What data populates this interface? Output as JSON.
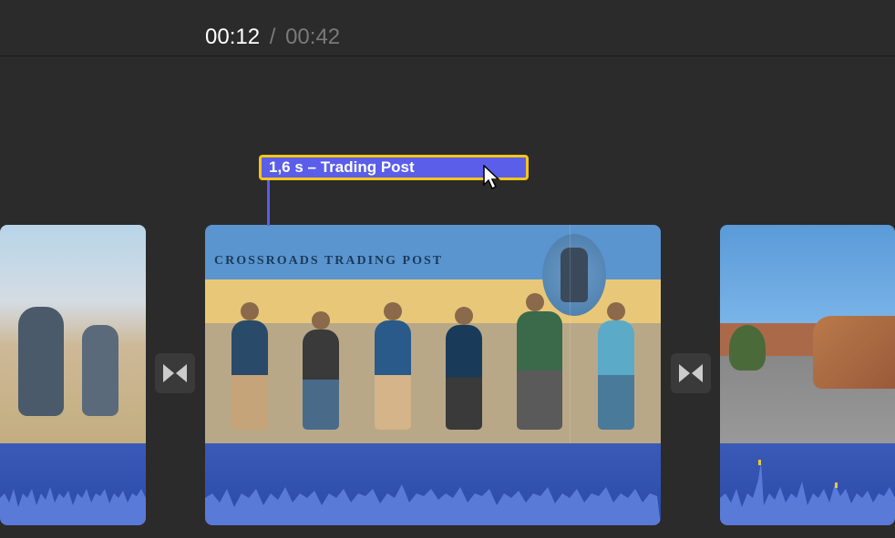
{
  "timecode": {
    "current": "00:12",
    "separator": "/",
    "total": "00:42"
  },
  "title_overlay": {
    "label": "1,6 s – Trading Post"
  },
  "clips": {
    "clip2_sign_text": "CROSSROADS  TRADING  POST"
  }
}
